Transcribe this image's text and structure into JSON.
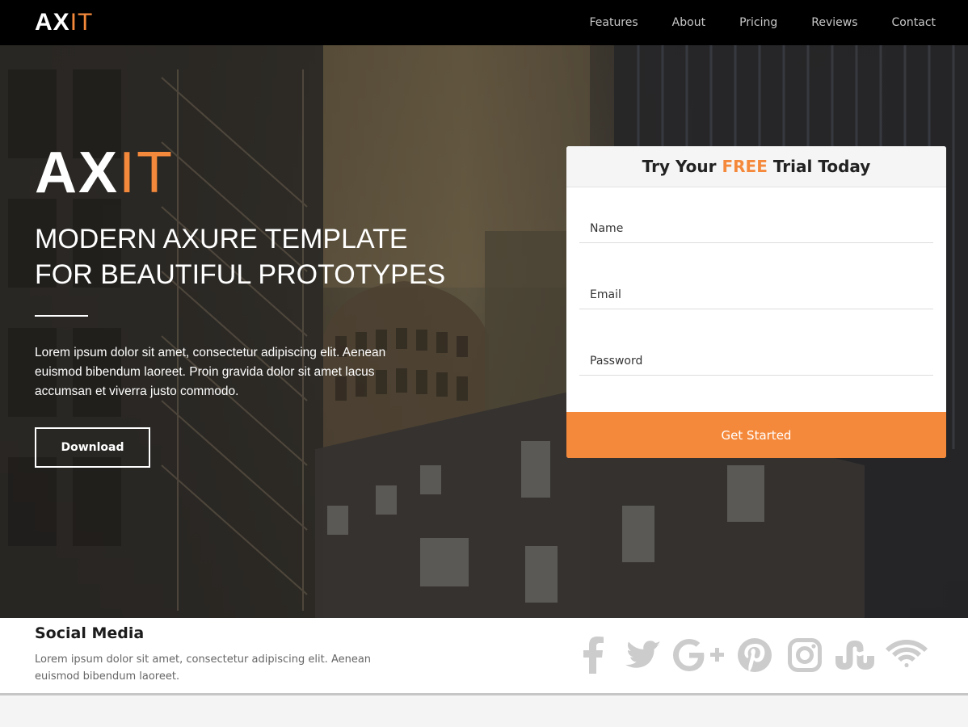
{
  "nav": {
    "logo_main": "AX",
    "logo_accent": "IT",
    "links": [
      "Features",
      "About",
      "Pricing",
      "Reviews",
      "Contact"
    ]
  },
  "hero": {
    "logo_main": "AX",
    "logo_accent": "IT",
    "title_line1": "MODERN AXURE TEMPLATE",
    "title_line2": "FOR BEAUTIFUL PROTOTYPES",
    "text": "Lorem ipsum dolor sit amet, consectetur adipiscing elit. Aenean euismod bibendum laoreet. Proin gravida dolor sit amet lacus accumsan et viverra justo commodo.",
    "download_label": "Download"
  },
  "form": {
    "title_before": "Try Your",
    "title_highlight": "FREE",
    "title_after": "Trial Today",
    "name_placeholder": "Name",
    "email_placeholder": "Email",
    "password_placeholder": "Password",
    "submit_label": "Get Started"
  },
  "social": {
    "title": "Social Media",
    "text": "Lorem ipsum dolor sit amet, consectetur adipiscing elit. Aenean euismod bibendum laoreet.",
    "icons": [
      "facebook-icon",
      "twitter-icon",
      "google-plus-icon",
      "pinterest-icon",
      "instagram-icon",
      "stumbleupon-icon",
      "rss-icon"
    ]
  },
  "colors": {
    "accent": "#f5893b",
    "nav_bg": "#000000",
    "icon_gray": "#cccccc"
  }
}
